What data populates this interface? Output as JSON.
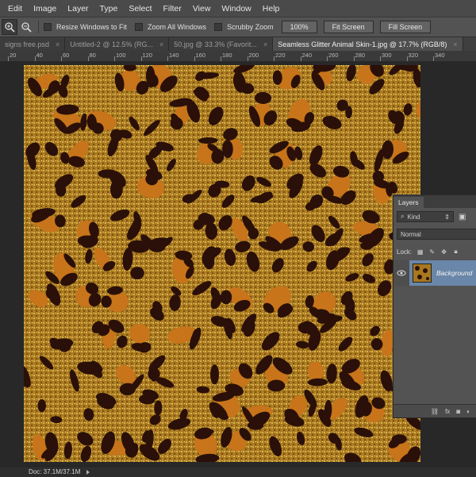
{
  "menu": [
    "Edit",
    "Image",
    "Layer",
    "Type",
    "Select",
    "Filter",
    "View",
    "Window",
    "Help"
  ],
  "options": {
    "resize_windows": "Resize Windows to Fit",
    "zoom_all": "Zoom All Windows",
    "scrubby_zoom": "Scrubby Zoom",
    "zoom_100": "100%",
    "fit_screen": "Fit Screen",
    "fill_screen": "Fill Screen"
  },
  "tabs": [
    {
      "label": "signs free.psd"
    },
    {
      "label": "Untitled-2 @ 12.5% (RG..."
    },
    {
      "label": "50.jpg @ 33.3% (Favorit..."
    },
    {
      "label": "Seamless Glitter Animal Skin-1.jpg @ 17.7% (RGB/8)"
    }
  ],
  "ruler_numbers": [
    "20",
    "40",
    "60",
    "80",
    "100",
    "120",
    "140",
    "160",
    "180",
    "200",
    "220",
    "240",
    "260",
    "280",
    "300",
    "320",
    "340"
  ],
  "status": {
    "doc": "Doc: 37.1M/37.1M"
  },
  "layers_panel": {
    "title": "Layers",
    "filter_kind": "Kind",
    "blend_mode": "Normal",
    "lock_label": "Lock:",
    "layer_name": "Background"
  },
  "colors": {
    "glitter": "#a8781f",
    "spot": "#2a1008",
    "orange": "#c8741a",
    "selected_layer": "#6a86a8"
  }
}
